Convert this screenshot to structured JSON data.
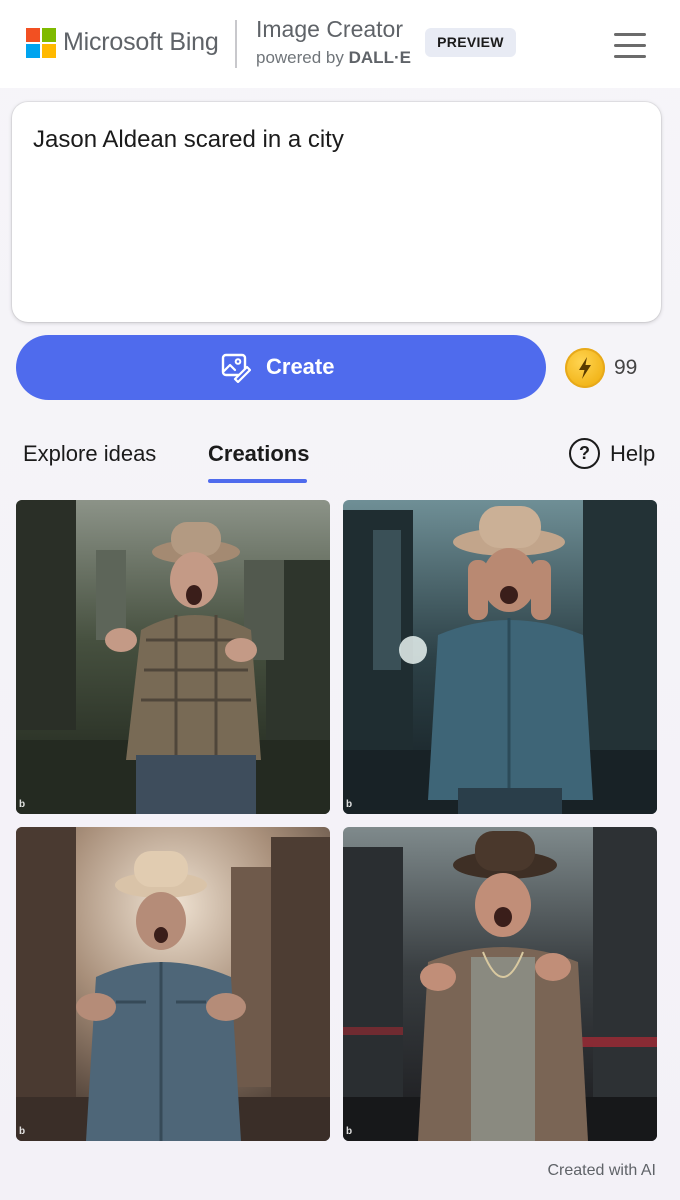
{
  "header": {
    "brand": "Microsoft Bing",
    "product_title": "Image Creator",
    "powered_by_prefix": "powered by ",
    "powered_by_model": "DALL·E",
    "badge": "PREVIEW",
    "menu_icon": "hamburger-icon",
    "logo_colors": [
      "#f25022",
      "#7fba00",
      "#00a4ef",
      "#ffb900"
    ]
  },
  "prompt": {
    "value": "Jason Aldean scared in a city"
  },
  "create": {
    "label": "Create",
    "icon": "image-create-icon",
    "boosts": "99",
    "boost_icon": "lightning-coin-icon"
  },
  "tabs": [
    {
      "label": "Explore ideas",
      "active": false
    },
    {
      "label": "Creations",
      "active": true
    }
  ],
  "help": {
    "label": "Help",
    "icon": "question-circle-icon"
  },
  "results": [
    {
      "watermark": "b",
      "scene": "ruined-street-green"
    },
    {
      "watermark": "b",
      "scene": "teal-street-denim"
    },
    {
      "watermark": "b",
      "scene": "hazy-warm-street"
    },
    {
      "watermark": "b",
      "scene": "dark-red-street"
    }
  ],
  "footer": {
    "note": "Created with AI"
  },
  "colors": {
    "accent": "#4f6bed",
    "text": "#1b1b1b",
    "muted": "#5f6368",
    "boost": "#f2b51a"
  }
}
